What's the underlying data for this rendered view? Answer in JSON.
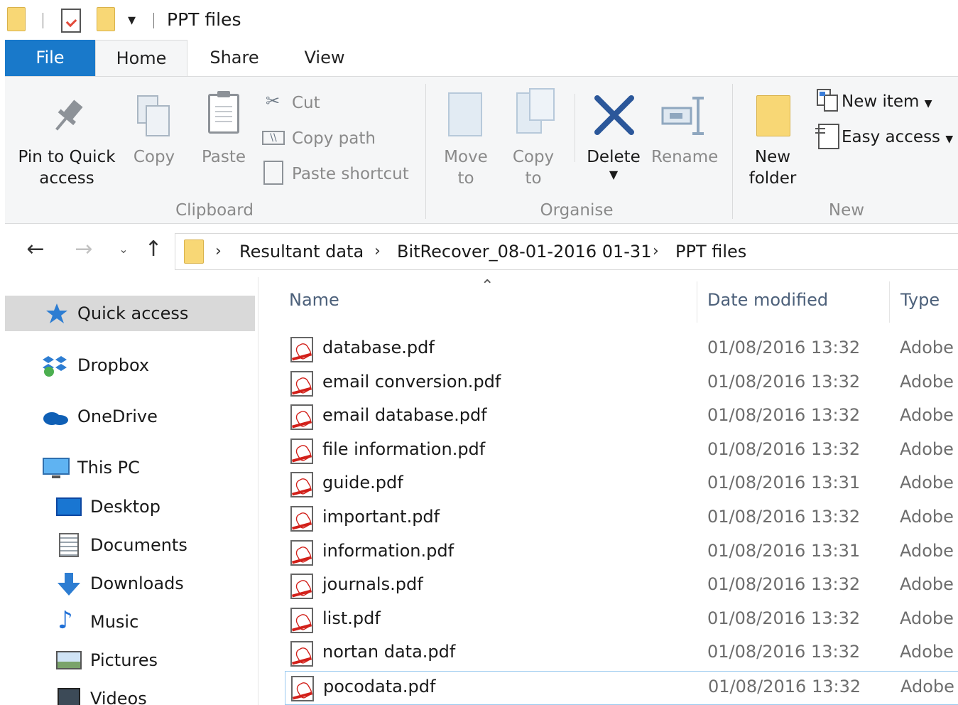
{
  "window": {
    "title": "PPT files"
  },
  "tabs": {
    "file": "File",
    "home": "Home",
    "share": "Share",
    "view": "View"
  },
  "ribbon": {
    "clipboard": {
      "pin_line1": "Pin to Quick",
      "pin_line2": "access",
      "copy": "Copy",
      "paste": "Paste",
      "cut": "Cut",
      "copy_path": "Copy path",
      "paste_shortcut": "Paste shortcut",
      "label": "Clipboard"
    },
    "organise": {
      "move_line1": "Move",
      "move_line2": "to",
      "copy_line1": "Copy",
      "copy_line2": "to",
      "delete": "Delete",
      "rename": "Rename",
      "label": "Organise"
    },
    "new": {
      "folder_line1": "New",
      "folder_line2": "folder",
      "new_item": "New item",
      "easy_access": "Easy access",
      "label": "New"
    }
  },
  "address": {
    "crumbs": [
      "Resultant data",
      "BitRecover_08-01-2016 01-31",
      "PPT files"
    ]
  },
  "sidebar": {
    "items": [
      {
        "label": "Quick access",
        "icon": "star-icon"
      },
      {
        "label": "Dropbox",
        "icon": "dropbox-icon"
      },
      {
        "label": "OneDrive",
        "icon": "onedrive-icon"
      },
      {
        "label": "This PC",
        "icon": "pc-icon"
      },
      {
        "label": "Desktop",
        "icon": "desktop-icon"
      },
      {
        "label": "Documents",
        "icon": "documents-icon"
      },
      {
        "label": "Downloads",
        "icon": "downloads-icon"
      },
      {
        "label": "Music",
        "icon": "music-icon"
      },
      {
        "label": "Pictures",
        "icon": "pictures-icon"
      },
      {
        "label": "Videos",
        "icon": "videos-icon"
      }
    ]
  },
  "files": {
    "columns": {
      "name": "Name",
      "date": "Date modified",
      "type": "Type"
    },
    "rows": [
      {
        "name": "database.pdf",
        "date": "01/08/2016 13:32",
        "type": "Adobe"
      },
      {
        "name": "email conversion.pdf",
        "date": "01/08/2016 13:32",
        "type": "Adobe"
      },
      {
        "name": "email database.pdf",
        "date": "01/08/2016 13:32",
        "type": "Adobe"
      },
      {
        "name": "file information.pdf",
        "date": "01/08/2016 13:32",
        "type": "Adobe"
      },
      {
        "name": "guide.pdf",
        "date": "01/08/2016 13:31",
        "type": "Adobe"
      },
      {
        "name": "important.pdf",
        "date": "01/08/2016 13:32",
        "type": "Adobe"
      },
      {
        "name": "information.pdf",
        "date": "01/08/2016 13:31",
        "type": "Adobe"
      },
      {
        "name": "journals.pdf",
        "date": "01/08/2016 13:32",
        "type": "Adobe"
      },
      {
        "name": "list.pdf",
        "date": "01/08/2016 13:32",
        "type": "Adobe"
      },
      {
        "name": "nortan data.pdf",
        "date": "01/08/2016 13:32",
        "type": "Adobe"
      },
      {
        "name": "pocodata.pdf",
        "date": "01/08/2016 13:32",
        "type": "Adobe"
      }
    ]
  }
}
